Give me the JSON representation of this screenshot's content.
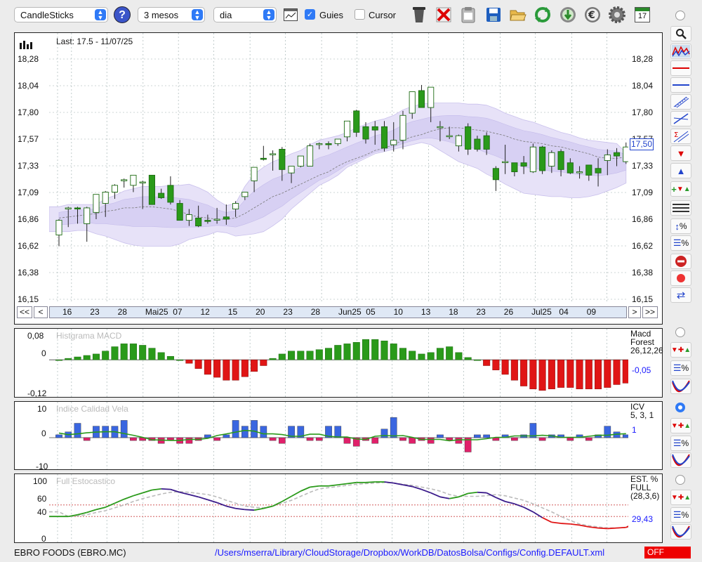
{
  "toolbar": {
    "chart_type": "CandleSticks",
    "period": "3 mesos",
    "interval": "dia",
    "guides_label": "Guies",
    "guides_checked": true,
    "cursor_label": "Cursor",
    "cursor_checked": false,
    "calendar_day": "17",
    "icons": [
      "help-icon",
      "chart-window-icon",
      "trash-icon",
      "delete-icon",
      "clipboard-icon",
      "save-icon",
      "open-folder-icon",
      "refresh-icon",
      "download-icon",
      "euro-icon",
      "settings-icon",
      "calendar-icon"
    ]
  },
  "main_chart": {
    "last_label": "Last: 17.5 - 11/07/25",
    "price_badge": "17,50",
    "y_ticks": [
      "18,28",
      "18,04",
      "17,80",
      "17,57",
      "17,33",
      "17,09",
      "16,86",
      "16,62",
      "16,38",
      "16,15"
    ],
    "date_labels": [
      "16",
      "23",
      "28",
      "Mai25",
      "07",
      "12",
      "15",
      "20",
      "23",
      "28",
      "Jun25",
      "05",
      "10",
      "13",
      "18",
      "23",
      "26",
      "Jul25",
      "04",
      "09"
    ],
    "nav": [
      "<<",
      "<",
      ">",
      ">>"
    ]
  },
  "macd_panel": {
    "title": "Histgrama MACD",
    "y_ticks": [
      "0,08",
      "0",
      "-0,12"
    ],
    "info_lines": [
      "Macd",
      "Forest",
      "26,12,26"
    ],
    "value": "-0,05"
  },
  "icv_panel": {
    "title": "Indice Calidad Vela",
    "y_ticks": [
      "10",
      "0",
      "-10"
    ],
    "info_lines": [
      "ICV",
      "5, 3, 1"
    ],
    "value": "1"
  },
  "stoch_panel": {
    "title": "Full Estocastico",
    "y_ticks": [
      "100",
      "60",
      "40",
      "0"
    ],
    "info_lines": [
      "EST. %",
      "FULL",
      "(28,3,6)"
    ],
    "value": "29,43"
  },
  "footer": {
    "company": "EBRO FOODS (EBRO.MC)",
    "path": "/Users/mserra/Library/CloudStorage/Dropbox/WorkDB/DatosBolsa/Configs/Config.DEFAULT.xml",
    "status": "OFF"
  },
  "colors": {
    "up": "#2a9a1a",
    "down": "#d81b1b",
    "bollinger": "#d9d2f3",
    "accent": "#2f7af6",
    "value_blue": "#1a1aff"
  },
  "chart_data": {
    "type": "candlestick",
    "candles": [
      {
        "o": 16.72,
        "h": 16.86,
        "l": 16.62,
        "c": 16.85
      },
      {
        "o": 16.95,
        "h": 16.97,
        "l": 16.79,
        "c": 16.96
      },
      {
        "o": 16.96,
        "h": 16.97,
        "l": 16.82,
        "c": 16.95
      },
      {
        "o": 16.82,
        "h": 16.97,
        "l": 16.66,
        "c": 16.96
      },
      {
        "o": 16.92,
        "h": 17.08,
        "l": 16.86,
        "c": 17.08
      },
      {
        "o": 17.0,
        "h": 17.11,
        "l": 16.88,
        "c": 17.1
      },
      {
        "o": 17.1,
        "h": 17.17,
        "l": 17.04,
        "c": 17.16
      },
      {
        "o": 17.2,
        "h": 17.22,
        "l": 17.14,
        "c": 17.21
      },
      {
        "o": 17.16,
        "h": 17.25,
        "l": 17.1,
        "c": 17.25
      },
      {
        "o": 17.19,
        "h": 17.2,
        "l": 16.95,
        "c": 17.19
      },
      {
        "o": 17.25,
        "h": 17.25,
        "l": 17.02,
        "c": 16.99
      },
      {
        "o": 17.09,
        "h": 17.13,
        "l": 17.04,
        "c": 17.05
      },
      {
        "o": 17.16,
        "h": 17.24,
        "l": 16.99,
        "c": 17.01
      },
      {
        "o": 17.0,
        "h": 17.03,
        "l": 16.88,
        "c": 16.85
      },
      {
        "o": 16.85,
        "h": 16.95,
        "l": 16.8,
        "c": 16.9
      },
      {
        "o": 16.87,
        "h": 16.98,
        "l": 16.79,
        "c": 16.8
      },
      {
        "o": 16.85,
        "h": 16.9,
        "l": 16.82,
        "c": 16.84
      },
      {
        "o": 16.86,
        "h": 16.96,
        "l": 16.82,
        "c": 16.86
      },
      {
        "o": 16.88,
        "h": 16.99,
        "l": 16.81,
        "c": 16.86
      },
      {
        "o": 16.95,
        "h": 17.02,
        "l": 16.88,
        "c": 17.0
      },
      {
        "o": 17.06,
        "h": 17.1,
        "l": 17.03,
        "c": 17.1
      },
      {
        "o": 17.2,
        "h": 17.31,
        "l": 17.1,
        "c": 17.32
      },
      {
        "o": 17.4,
        "h": 17.51,
        "l": 17.38,
        "c": 17.39
      },
      {
        "o": 17.44,
        "h": 17.47,
        "l": 17.29,
        "c": 17.44
      },
      {
        "o": 17.48,
        "h": 17.5,
        "l": 17.2,
        "c": 17.3
      },
      {
        "o": 17.27,
        "h": 17.33,
        "l": 17.18,
        "c": 17.33
      },
      {
        "o": 17.33,
        "h": 17.42,
        "l": 17.32,
        "c": 17.42
      },
      {
        "o": 17.33,
        "h": 17.53,
        "l": 17.33,
        "c": 17.51
      },
      {
        "o": 17.53,
        "h": 17.54,
        "l": 17.48,
        "c": 17.53
      },
      {
        "o": 17.53,
        "h": 17.55,
        "l": 17.48,
        "c": 17.52
      },
      {
        "o": 17.53,
        "h": 17.57,
        "l": 17.51,
        "c": 17.57
      },
      {
        "o": 17.59,
        "h": 17.73,
        "l": 17.55,
        "c": 17.73
      },
      {
        "o": 17.82,
        "h": 17.83,
        "l": 17.59,
        "c": 17.63
      },
      {
        "o": 17.68,
        "h": 17.72,
        "l": 17.53,
        "c": 17.57
      },
      {
        "o": 17.68,
        "h": 17.73,
        "l": 17.52,
        "c": 17.65
      },
      {
        "o": 17.68,
        "h": 17.73,
        "l": 17.46,
        "c": 17.49
      },
      {
        "o": 17.52,
        "h": 17.72,
        "l": 17.46,
        "c": 17.56
      },
      {
        "o": 17.56,
        "h": 17.82,
        "l": 17.48,
        "c": 17.78
      },
      {
        "o": 17.8,
        "h": 17.97,
        "l": 17.75,
        "c": 17.99
      },
      {
        "o": 18.0,
        "h": 18.05,
        "l": 17.85,
        "c": 17.85
      },
      {
        "o": 17.85,
        "h": 18.03,
        "l": 17.72,
        "c": 18.03
      },
      {
        "o": 17.68,
        "h": 17.73,
        "l": 17.55,
        "c": 17.68
      },
      {
        "o": 17.6,
        "h": 17.68,
        "l": 17.57,
        "c": 17.6
      },
      {
        "o": 17.51,
        "h": 17.61,
        "l": 17.46,
        "c": 17.6
      },
      {
        "o": 17.68,
        "h": 17.71,
        "l": 17.43,
        "c": 17.48
      },
      {
        "o": 17.57,
        "h": 17.6,
        "l": 17.46,
        "c": 17.48
      },
      {
        "o": 17.6,
        "h": 17.63,
        "l": 17.43,
        "c": 17.48
      },
      {
        "o": 17.31,
        "h": 17.33,
        "l": 17.11,
        "c": 17.21
      },
      {
        "o": 17.37,
        "h": 17.52,
        "l": 17.26,
        "c": 17.37
      },
      {
        "o": 17.36,
        "h": 17.36,
        "l": 17.24,
        "c": 17.28
      },
      {
        "o": 17.36,
        "h": 17.42,
        "l": 17.26,
        "c": 17.33
      },
      {
        "o": 17.28,
        "h": 17.53,
        "l": 17.27,
        "c": 17.5
      },
      {
        "o": 17.5,
        "h": 17.51,
        "l": 17.26,
        "c": 17.29
      },
      {
        "o": 17.33,
        "h": 17.47,
        "l": 17.27,
        "c": 17.45
      },
      {
        "o": 17.46,
        "h": 17.48,
        "l": 17.24,
        "c": 17.3
      },
      {
        "o": 17.36,
        "h": 17.4,
        "l": 17.26,
        "c": 17.27
      },
      {
        "o": 17.28,
        "h": 17.33,
        "l": 17.22,
        "c": 17.28
      },
      {
        "o": 17.34,
        "h": 17.34,
        "l": 17.2,
        "c": 17.25
      },
      {
        "o": 17.31,
        "h": 17.4,
        "l": 17.15,
        "c": 17.27
      },
      {
        "o": 17.38,
        "h": 17.48,
        "l": 17.25,
        "c": 17.43
      },
      {
        "o": 17.45,
        "h": 17.49,
        "l": 17.33,
        "c": 17.42
      },
      {
        "o": 17.37,
        "h": 17.54,
        "l": 17.35,
        "c": 17.5
      }
    ],
    "bollinger_upper": [
      16.97,
      16.99,
      16.99,
      16.99,
      16.99,
      17.04,
      17.07,
      17.11,
      17.13,
      17.15,
      17.15,
      17.15,
      17.16,
      17.16,
      17.17,
      17.14,
      17.1,
      17.03,
      16.98,
      17.0,
      17.15,
      17.26,
      17.32,
      17.37,
      17.4,
      17.44,
      17.47,
      17.52,
      17.56,
      17.58,
      17.6,
      17.63,
      17.67,
      17.7,
      17.73,
      17.75,
      17.78,
      17.83,
      17.86,
      17.88,
      17.89,
      17.89,
      17.89,
      17.89,
      17.88,
      17.88,
      17.87,
      17.84,
      17.8,
      17.77,
      17.74,
      17.72,
      17.69,
      17.66,
      17.63,
      17.61,
      17.58,
      17.56,
      17.55,
      17.54,
      17.53,
      17.45
    ],
    "bollinger_middle": [
      16.87,
      16.88,
      16.89,
      16.9,
      16.91,
      16.93,
      16.94,
      16.96,
      16.96,
      16.97,
      16.97,
      16.96,
      16.95,
      16.93,
      16.9,
      16.88,
      16.87,
      16.86,
      16.86,
      16.87,
      16.91,
      16.96,
      17.01,
      17.06,
      17.09,
      17.13,
      17.17,
      17.21,
      17.25,
      17.28,
      17.33,
      17.37,
      17.4,
      17.43,
      17.47,
      17.49,
      17.52,
      17.56,
      17.59,
      17.61,
      17.64,
      17.66,
      17.67,
      17.67,
      17.66,
      17.65,
      17.64,
      17.62,
      17.6,
      17.57,
      17.55,
      17.54,
      17.53,
      17.51,
      17.5,
      17.48,
      17.46,
      17.44,
      17.41,
      17.4,
      17.4,
      17.41
    ],
    "bollinger_lower": [
      16.75,
      16.75,
      16.76,
      16.76,
      16.73,
      16.71,
      16.68,
      16.65,
      16.63,
      16.62,
      16.62,
      16.62,
      16.62,
      16.64,
      16.68,
      16.7,
      16.72,
      16.75,
      16.74,
      16.71,
      16.72,
      16.73,
      16.75,
      16.8,
      16.86,
      16.95,
      17.02,
      17.09,
      17.16,
      17.2,
      17.25,
      17.32,
      17.36,
      17.4,
      17.44,
      17.46,
      17.48,
      17.5,
      17.52,
      17.54,
      17.52,
      17.47,
      17.42,
      17.37,
      17.34,
      17.31,
      17.26,
      17.22,
      17.17,
      17.13,
      17.09,
      17.08,
      17.07,
      17.06,
      17.06,
      17.05,
      17.05,
      17.06,
      17.08,
      17.11,
      17.14,
      17.18
    ],
    "macd_hist": [
      0,
      0.005,
      0.01,
      0.015,
      0.02,
      0.03,
      0.045,
      0.055,
      0.055,
      0.05,
      0.04,
      0.025,
      0.012,
      0,
      -0.012,
      -0.03,
      -0.05,
      -0.06,
      -0.07,
      -0.07,
      -0.058,
      -0.04,
      -0.02,
      0.005,
      0.02,
      0.03,
      0.03,
      0.03,
      0.035,
      0.04,
      0.05,
      0.055,
      0.06,
      0.07,
      0.07,
      0.065,
      0.055,
      0.04,
      0.03,
      0.02,
      0.025,
      0.04,
      0.045,
      0.025,
      0.008,
      0,
      -0.02,
      -0.035,
      -0.05,
      -0.07,
      -0.09,
      -0.1,
      -0.105,
      -0.1,
      -0.095,
      -0.095,
      -0.1,
      -0.1,
      -0.1,
      -0.095,
      -0.085,
      -0.08,
      -0.05
    ],
    "icv": [
      1,
      2,
      5,
      -1,
      4,
      4,
      4,
      6,
      -1,
      -1,
      -1,
      -2,
      -1,
      -2,
      -2,
      -1,
      1,
      -1,
      1,
      6,
      4,
      6,
      4,
      -1,
      -2,
      4,
      4,
      -1,
      -1,
      4,
      4,
      -2,
      -3,
      -1,
      -2,
      3,
      7,
      -1,
      -2,
      -1,
      -2,
      1,
      -1,
      -2,
      -5,
      1,
      1,
      -1,
      1,
      -1,
      1,
      5,
      -1,
      1,
      1,
      -1,
      1,
      -1,
      1,
      4,
      2,
      1
    ],
    "stoch_k": [
      40,
      40,
      43,
      47,
      52,
      56,
      63,
      70,
      76,
      81,
      86,
      88,
      87,
      82,
      78,
      74,
      69,
      64,
      58,
      54,
      52,
      51,
      54,
      58,
      66,
      75,
      84,
      91,
      93,
      93,
      95,
      97,
      99,
      99,
      100,
      100,
      98,
      95,
      92,
      87,
      81,
      74,
      71,
      74,
      80,
      82,
      81,
      73,
      66,
      62,
      56,
      48,
      38,
      30,
      28,
      27,
      25,
      22,
      20,
      19,
      20,
      21,
      29
    ],
    "stoch_d": [
      48,
      40,
      41,
      43,
      47,
      50,
      55,
      60,
      66,
      71,
      75,
      79,
      82,
      83,
      82,
      80,
      78,
      74,
      68,
      63,
      58,
      56,
      55,
      58,
      63,
      68,
      75,
      82,
      88,
      90,
      92,
      94,
      96,
      97,
      98,
      99,
      98,
      96,
      94,
      91,
      88,
      84,
      78,
      75,
      75,
      75,
      76,
      78,
      76,
      72,
      68,
      62,
      55,
      48,
      40,
      33,
      27,
      24,
      22,
      20,
      20,
      21,
      24
    ]
  }
}
